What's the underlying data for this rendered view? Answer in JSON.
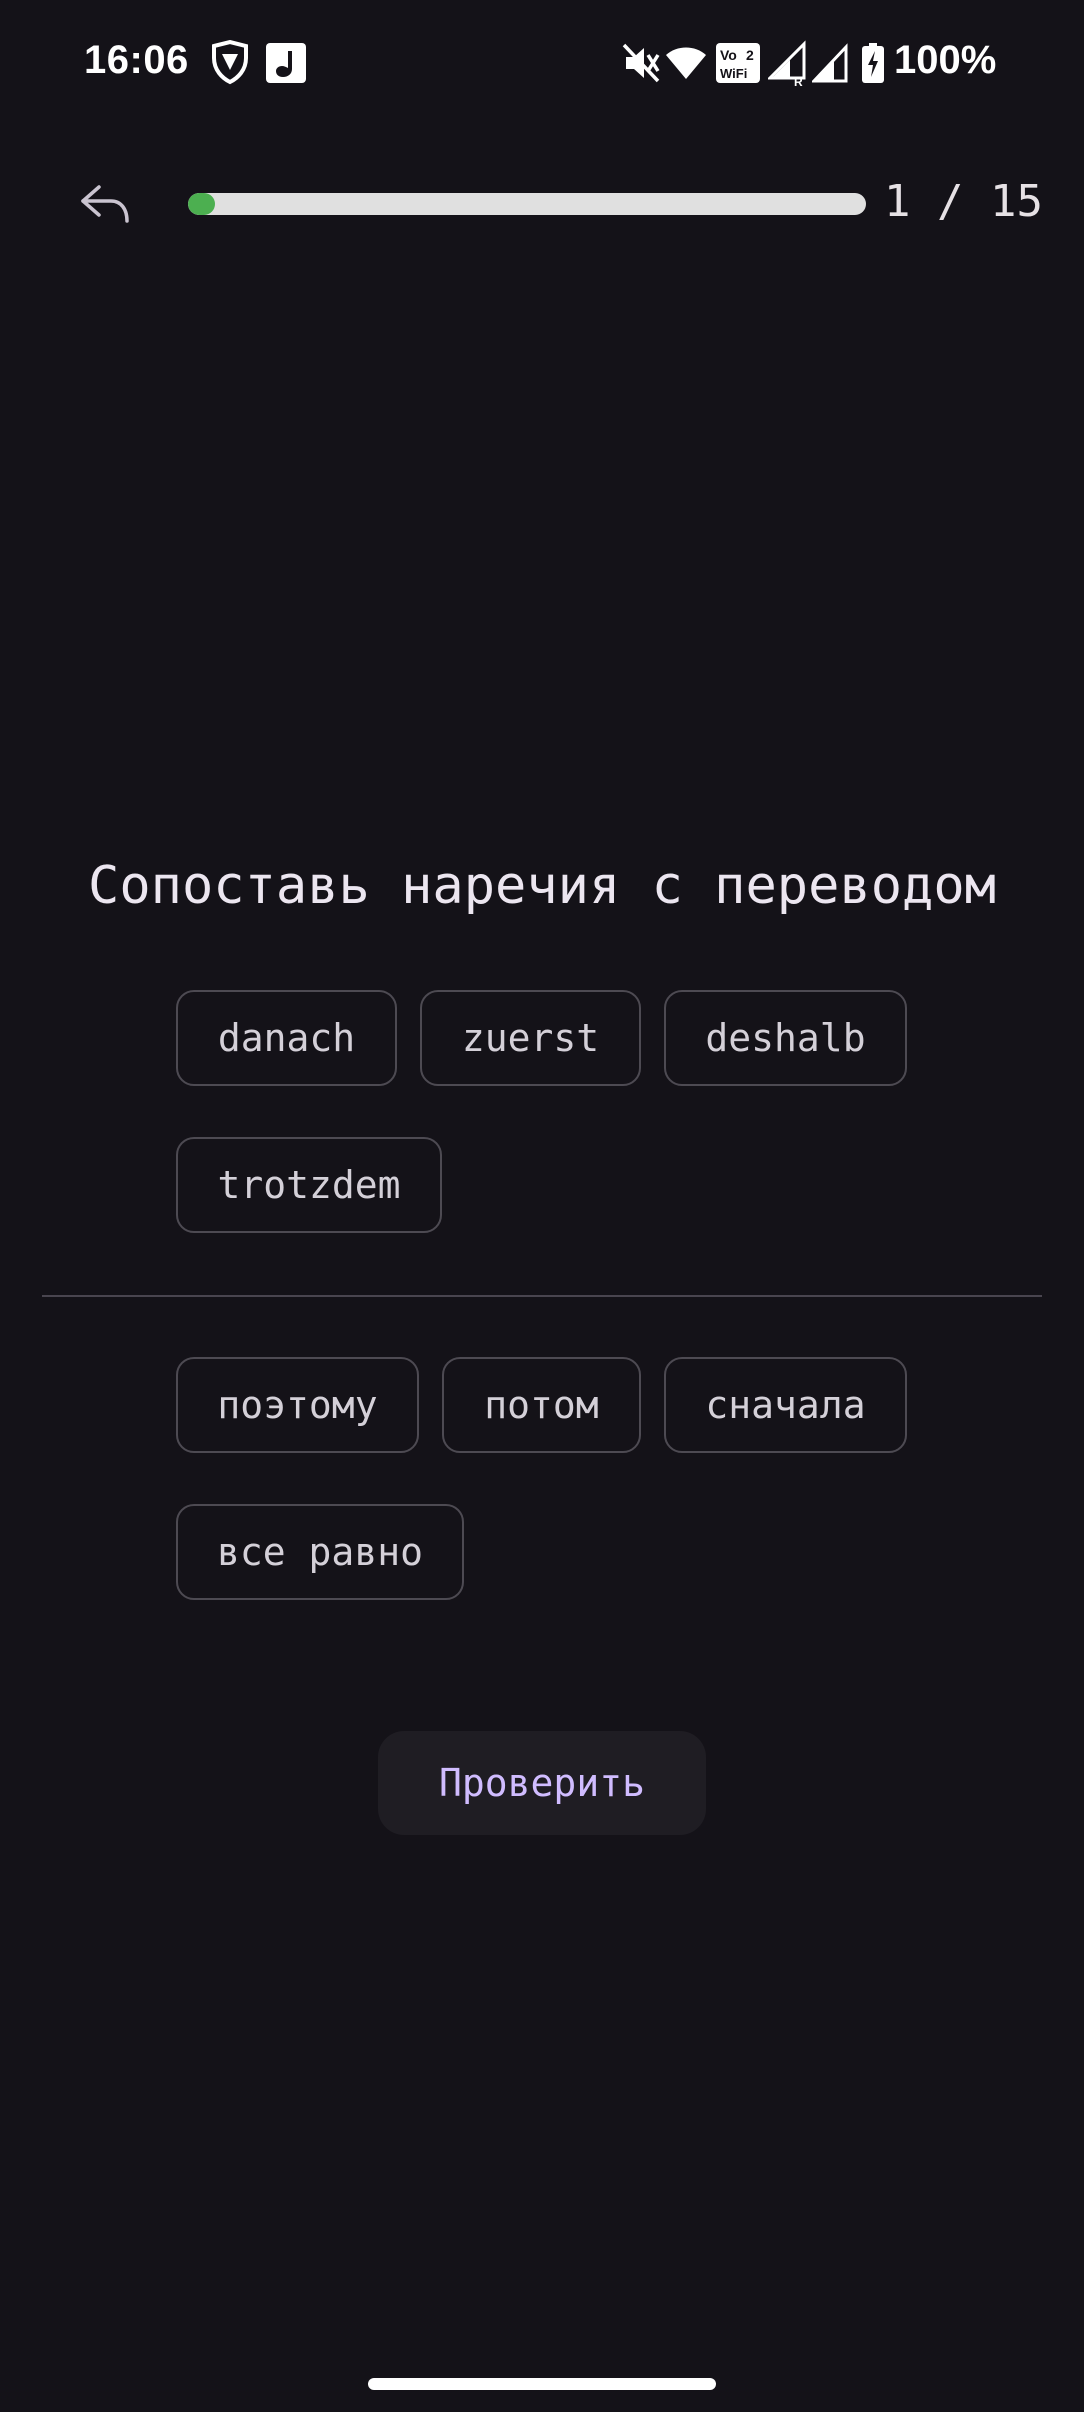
{
  "status_bar": {
    "time": "16:06",
    "battery_text": "100%",
    "icons": [
      "vpn-shield-icon",
      "app-notification-icon",
      "mute-icon",
      "wifi-icon",
      "vowifi-icon",
      "signal-roaming-icon",
      "signal-icon",
      "battery-charging-icon"
    ],
    "vowifi_top": "Vo",
    "vowifi_sim": "2",
    "vowifi_bottom": "WiFi",
    "roaming_label": "R"
  },
  "top_bar": {
    "back_icon": "undo-arrow-icon",
    "progress_label": "1 / 15",
    "progress_current": 1,
    "progress_total": 15,
    "progress_color": "#4caf50",
    "track_color": "#e0e0e0"
  },
  "exercise": {
    "title": "Сопоставь наречия с переводом",
    "german_words": [
      "danach",
      "zuerst",
      "deshalb",
      "trotzdem"
    ],
    "russian_words": [
      "поэтому",
      "потом",
      "сначала",
      "все равно"
    ],
    "check_button_label": "Проверить",
    "accent_color": "#d0bcff"
  }
}
